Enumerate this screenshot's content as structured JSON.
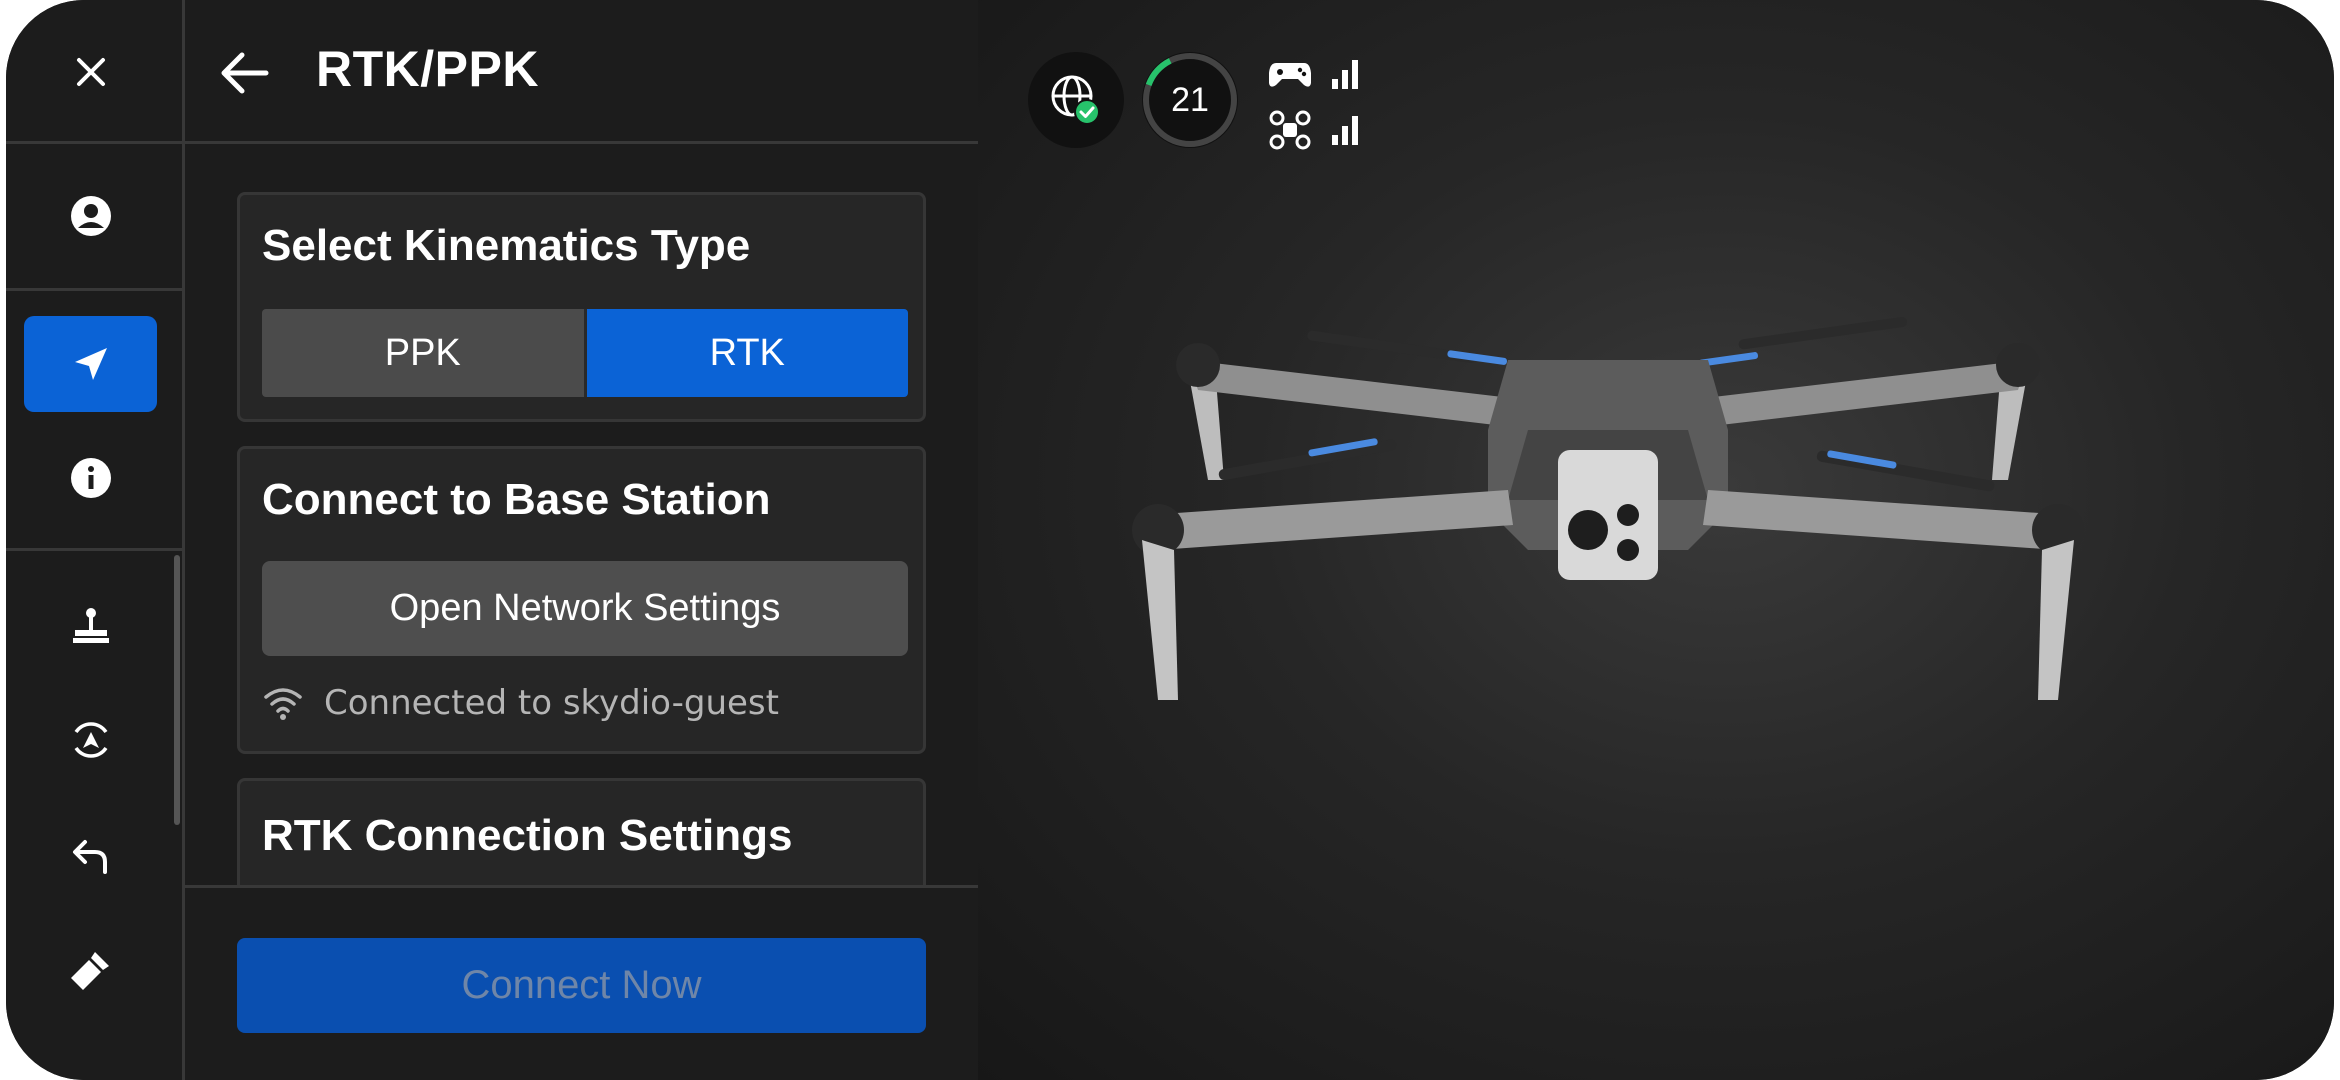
{
  "header": {
    "title": "RTK/PPK"
  },
  "kinematics": {
    "heading": "Select Kinematics Type",
    "options": [
      "PPK",
      "RTK"
    ],
    "selected": "RTK"
  },
  "base_station": {
    "heading": "Connect to Base Station",
    "button_label": "Open Network Settings",
    "status_text": "Connected to skydio-guest"
  },
  "rtk_settings": {
    "heading": "RTK Connection Settings"
  },
  "footer": {
    "connect_label": "Connect Now"
  },
  "status_bar": {
    "battery_value": "21",
    "gps_status": "ok"
  },
  "colors": {
    "accent": "#0b63d6",
    "panel": "#262626",
    "background": "#1c1c1c",
    "gps_ok": "#27c26b"
  },
  "icons": {
    "rail": [
      "close-icon",
      "account-icon",
      "navigation-arrow-icon",
      "info-icon",
      "joystick-icon",
      "landing-icon",
      "return-icon",
      "flashlight-icon"
    ],
    "header": "back-arrow-icon",
    "status": [
      "gps-globe-icon",
      "controller-icon",
      "drone-icon",
      "signal-bars-icon",
      "wifi-icon"
    ]
  }
}
